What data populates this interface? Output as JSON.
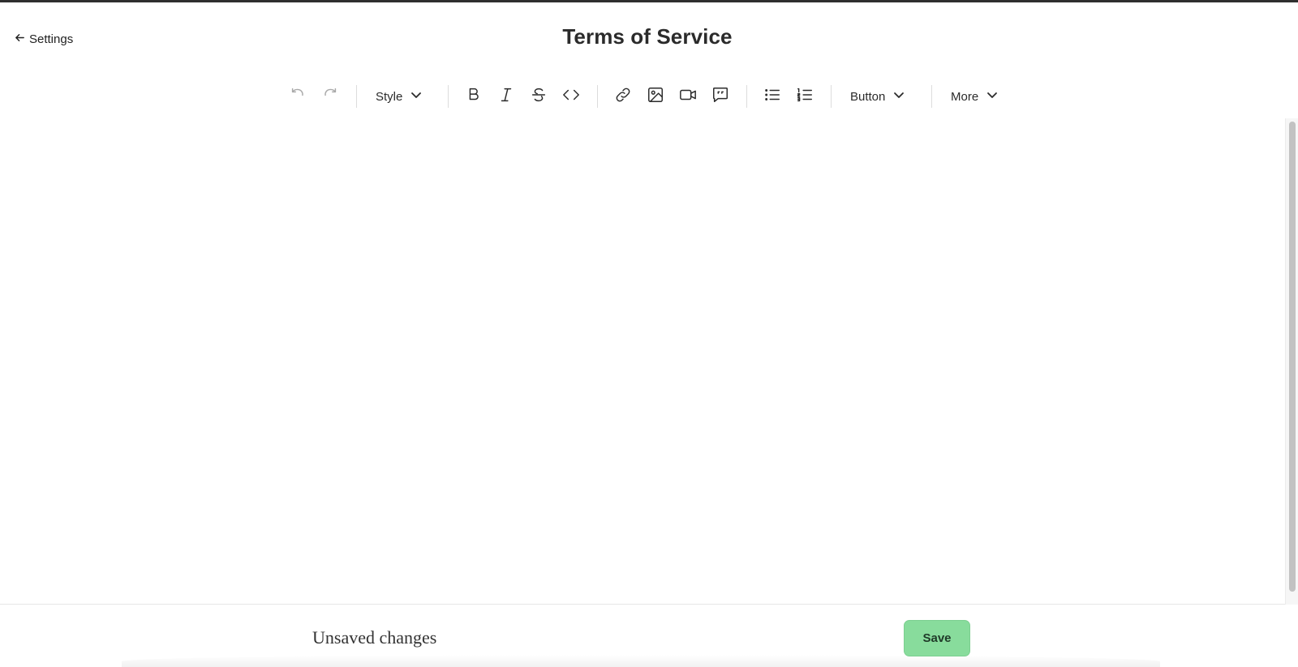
{
  "header": {
    "back_label": "Settings",
    "title": "Terms of Service"
  },
  "toolbar": {
    "undo_icon": "undo-icon",
    "redo_icon": "redo-icon",
    "style_label": "Style",
    "bold_icon": "bold-icon",
    "italic_icon": "italic-icon",
    "strike_icon": "strikethrough-icon",
    "code_icon": "code-icon",
    "link_icon": "link-icon",
    "image_icon": "image-icon",
    "video_icon": "video-icon",
    "quote_icon": "quote-bubble-icon",
    "bullet_list_icon": "bullet-list-icon",
    "numbered_list_icon": "numbered-list-icon",
    "button_label": "Button",
    "more_label": "More"
  },
  "footer": {
    "status": "Unsaved changes",
    "save_label": "Save",
    "save_color": "#88dc9c"
  }
}
